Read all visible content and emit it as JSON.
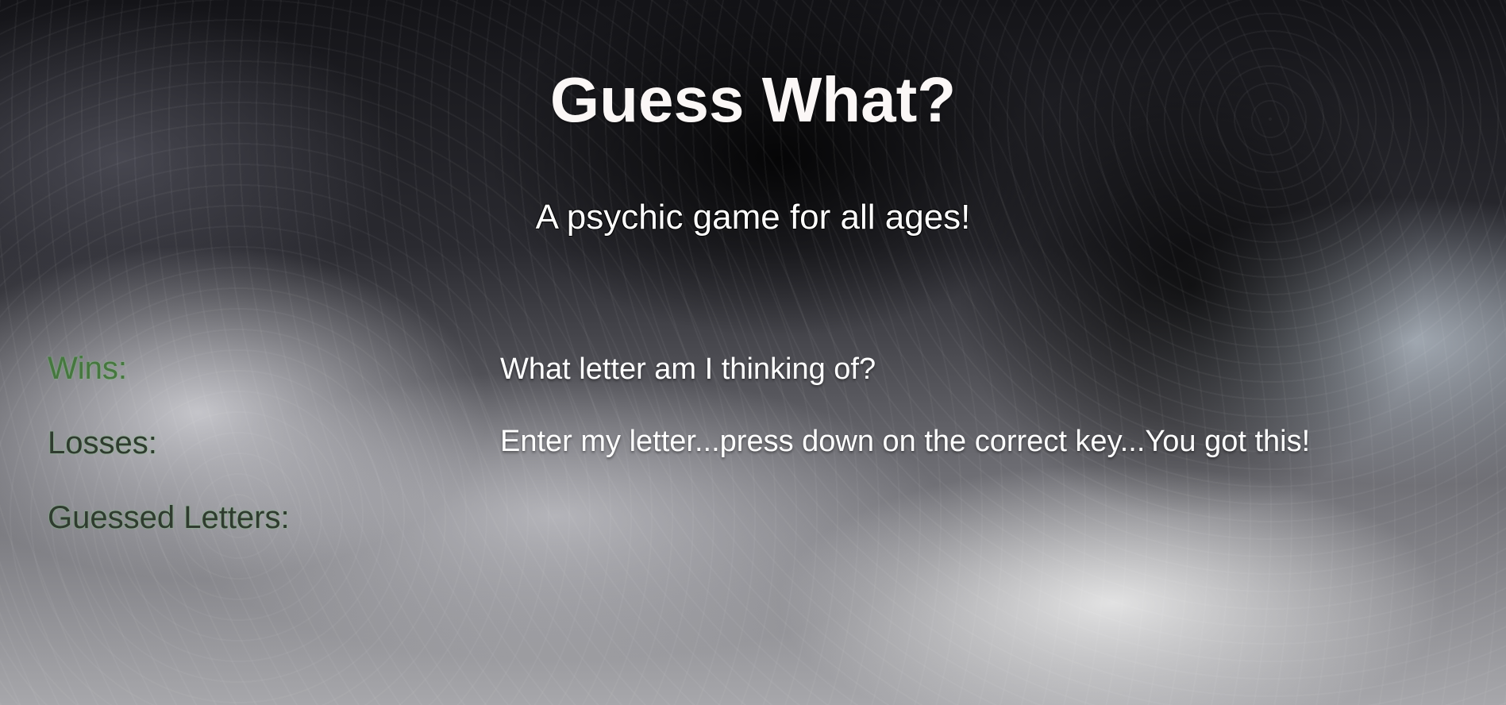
{
  "header": {
    "title": "Guess What?",
    "subtitle": "A psychic game for all ages!"
  },
  "stats": {
    "wins_label": "Wins:",
    "losses_label": "Losses:",
    "guessed_letters_label": "Guessed Letters:"
  },
  "prompts": {
    "question": "What letter am I thinking of?",
    "instruction": "Enter my letter...press down on the correct key...You got this!"
  }
}
